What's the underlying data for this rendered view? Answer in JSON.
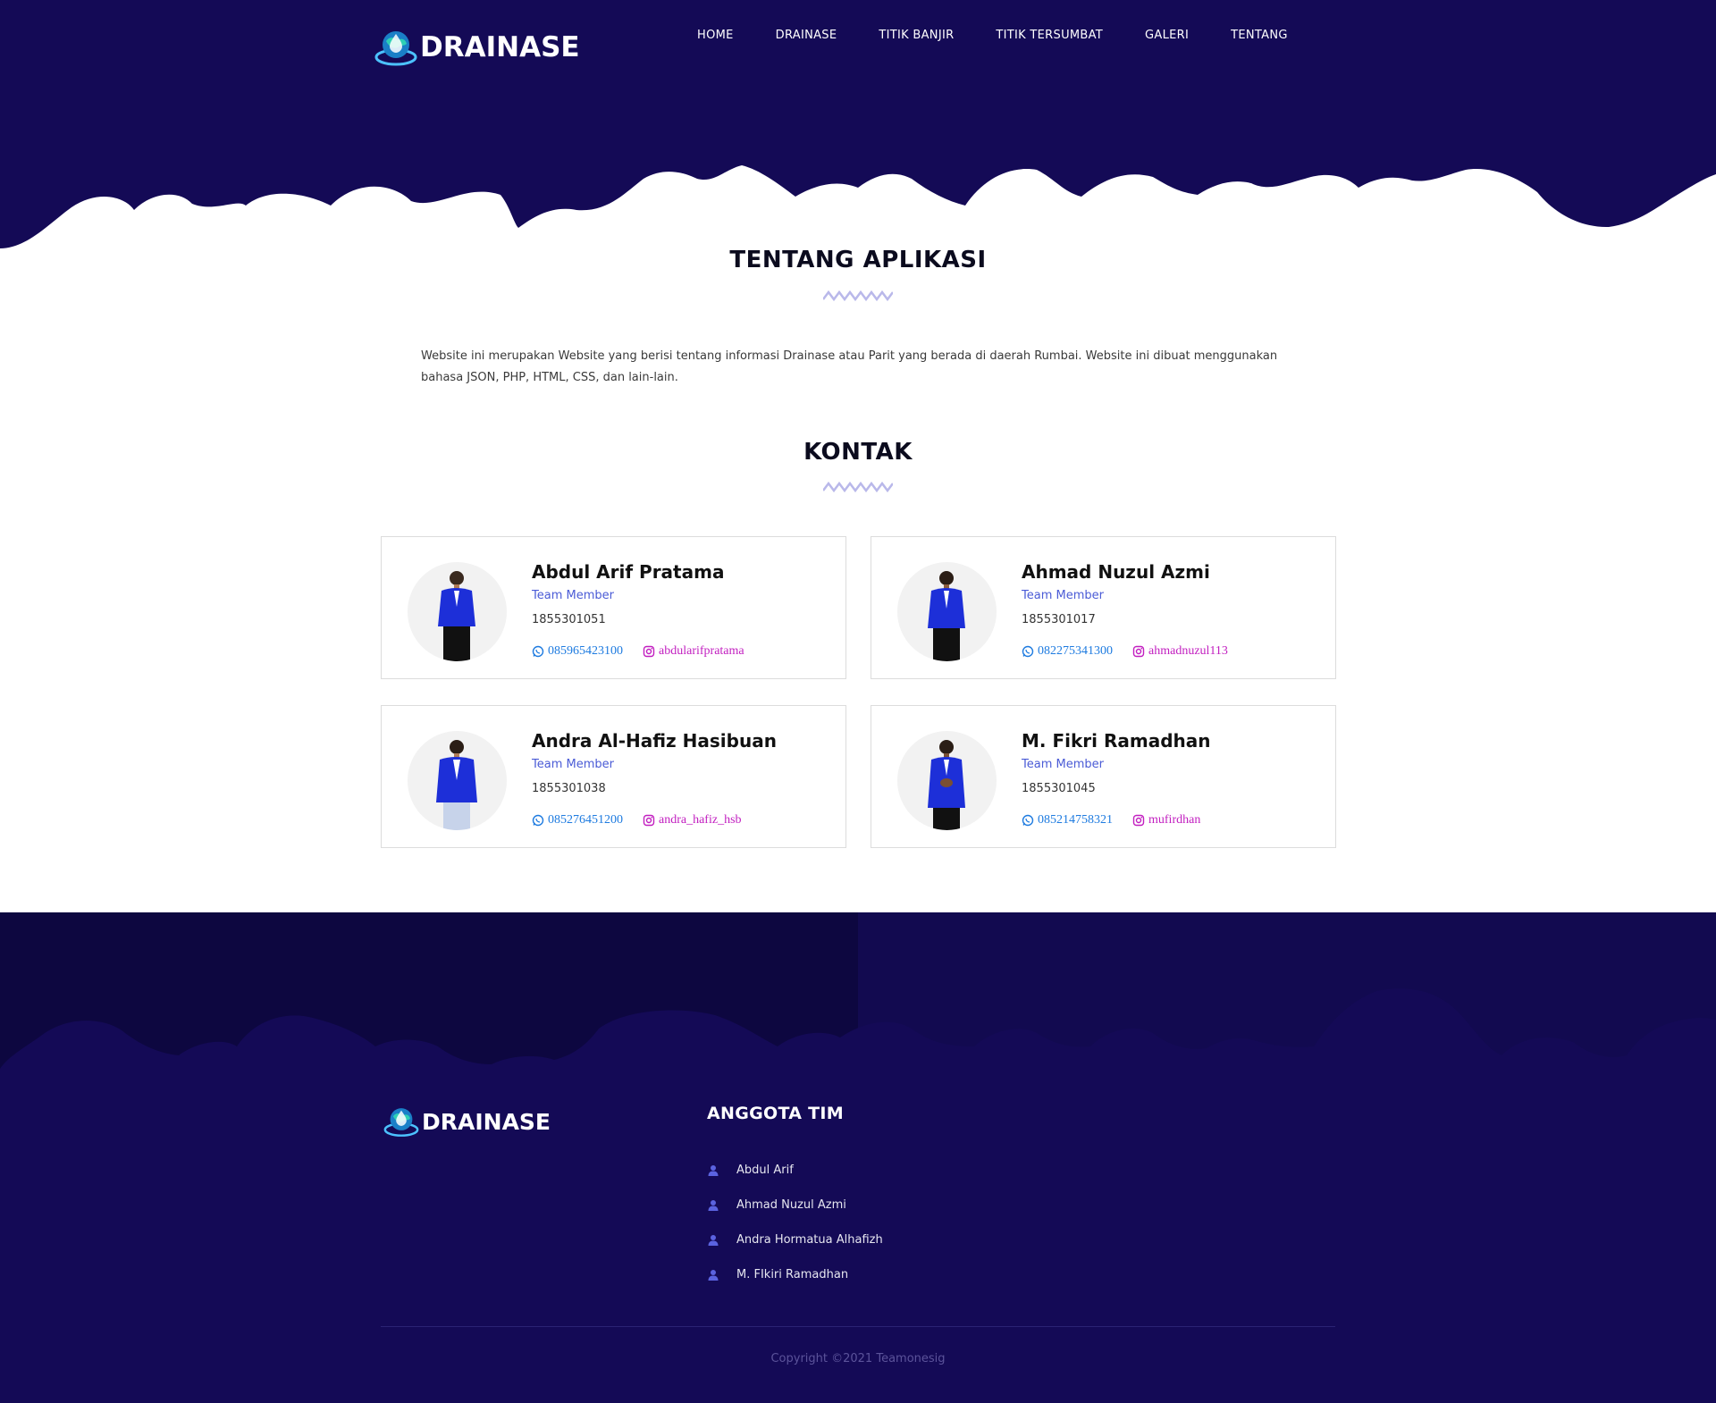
{
  "brand": {
    "name": "DRAINASE",
    "colors": {
      "navy": "#140a56",
      "accent": "#4a5bd6",
      "whatsapp": "#1e7be0",
      "instagram": "#c21fc0"
    }
  },
  "nav": {
    "items": [
      "HOME",
      "DRAINASE",
      "TITIK BANJIR",
      "TITIK TERSUMBAT",
      "GALERI",
      "TENTANG"
    ]
  },
  "about": {
    "title": "TENTANG APLIKASI",
    "text": "Website ini merupakan Website yang berisi tentang informasi Drainase atau Parit yang berada di daerah Rumbai. Website ini dibuat menggunakan bahasa JSON, PHP, HTML, CSS, dan lain-lain."
  },
  "contact": {
    "title": "KONTAK",
    "members": [
      {
        "name": "Abdul Arif Pratama",
        "role": "Team Member",
        "id": "1855301051",
        "whatsapp": "085965423100",
        "instagram": "abdularifpratama",
        "icons": [
          "whatsapp-icon",
          "instagram-icon"
        ]
      },
      {
        "name": "Ahmad Nuzul Azmi",
        "role": "Team Member",
        "id": "1855301017",
        "whatsapp": "082275341300",
        "instagram": "ahmadnuzul113",
        "icons": [
          "whatsapp-icon",
          "instagram-icon"
        ]
      },
      {
        "name": "Andra Al-Hafiz Hasibuan",
        "role": "Team Member",
        "id": "1855301038",
        "whatsapp": "085276451200",
        "instagram": "andra_hafiz_hsb",
        "icons": [
          "whatsapp-icon",
          "instagram-icon"
        ]
      },
      {
        "name": "M. Fikri Ramadhan",
        "role": "Team Member",
        "id": "1855301045",
        "whatsapp": "085214758321",
        "instagram": "mufirdhan",
        "icons": [
          "whatsapp-icon",
          "instagram-icon"
        ]
      }
    ]
  },
  "footer": {
    "team_title": "ANGGOTA TIM",
    "team": [
      "Abdul Arif",
      "Ahmad Nuzul Azmi",
      "Andra Hormatua Alhafizh",
      "M. FIkiri Ramadhan"
    ],
    "team_icon": "user-icon",
    "copyright": "Copyright ©2021 Teamonesig"
  }
}
